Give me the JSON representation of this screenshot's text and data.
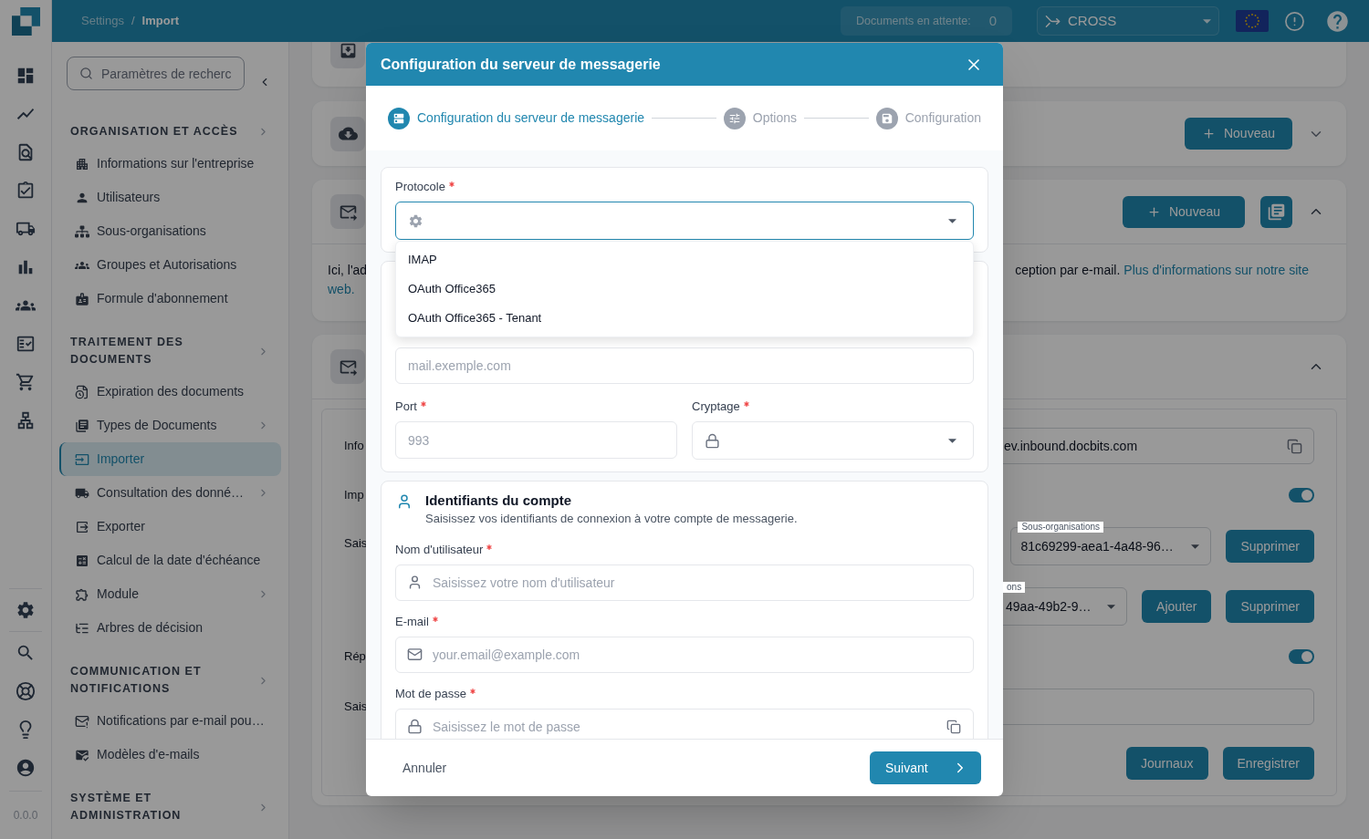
{
  "rail": {
    "version": "0.0.0"
  },
  "topbar": {
    "breadcrumb": [
      {
        "label": "Settings",
        "current": false
      },
      {
        "label": "Import",
        "current": true
      }
    ],
    "separator": "/",
    "pending": {
      "label": "Documents en attente:",
      "count": "0"
    },
    "workspace": {
      "value": "CROSS"
    }
  },
  "sidebar": {
    "search": {
      "placeholder": "Paramètres de recherc"
    },
    "sections": [
      {
        "title": "ORGANISATION ET ACCÈS",
        "items": [
          {
            "label": "Informations sur l'entreprise",
            "selected": false,
            "expandable": false
          },
          {
            "label": "Utilisateurs",
            "selected": false,
            "expandable": false
          },
          {
            "label": "Sous-organisations",
            "selected": false,
            "expandable": false
          },
          {
            "label": "Groupes et Autorisations",
            "selected": false,
            "expandable": false
          },
          {
            "label": "Formule d'abonnement",
            "selected": false,
            "expandable": false
          }
        ]
      },
      {
        "title": "TRAITEMENT DES DOCUMENTS",
        "items": [
          {
            "label": "Expiration des documents",
            "selected": false,
            "expandable": false
          },
          {
            "label": "Types de Documents",
            "selected": false,
            "expandable": true
          },
          {
            "label": "Importer",
            "selected": true,
            "expandable": false
          },
          {
            "label": "Consultation des donné…",
            "selected": false,
            "expandable": true
          },
          {
            "label": "Exporter",
            "selected": false,
            "expandable": false
          },
          {
            "label": "Calcul de la date d'échéance",
            "selected": false,
            "expandable": false
          },
          {
            "label": "Module",
            "selected": false,
            "expandable": true
          },
          {
            "label": "Arbres de décision",
            "selected": false,
            "expandable": false
          }
        ]
      },
      {
        "title": "COMMUNICATION ET NOTIFICATIONS",
        "items": [
          {
            "label": "Notifications par e-mail pou…",
            "selected": false,
            "expandable": false
          },
          {
            "label": "Modèles d'e-mails",
            "selected": false,
            "expandable": false
          }
        ]
      },
      {
        "title": "SYSTÈME ET ADMINISTRATION"
      }
    ]
  },
  "main": {
    "cards": [
      {
        "kind": "partial"
      },
      {
        "kind": "import",
        "expanded": false,
        "actions": [
          {
            "kind": "new",
            "label": "Nouveau"
          }
        ]
      },
      {
        "kind": "info",
        "expanded": true,
        "actions": [
          {
            "kind": "new",
            "label": "Nouveau"
          },
          {
            "kind": "docs"
          }
        ],
        "intro": {
          "start": "Ici, l'ad",
          "end": "ception par e-mail.",
          "link": "Plus d'informations sur notre site",
          "link_rest": "web."
        }
      },
      {
        "kind": "settings",
        "expanded": true,
        "rows": [
          {
            "kind": "copy_field",
            "label": "Info",
            "value": "ev.inbound.docbits.com"
          },
          {
            "kind": "toggle",
            "label": "Imp",
            "on": true
          },
          {
            "kind": "select",
            "label": "Sais",
            "select_label": "Sous-organisations",
            "value": "81c69299-aea1-4a48-96…",
            "buttons": [
              "Supprimer"
            ]
          },
          {
            "kind": "select",
            "select_label": "ons",
            "value": "49aa-49b2-9…",
            "buttons": [
              "Ajouter",
              "Supprimer"
            ]
          },
          {
            "kind": "toggle",
            "label": "Rép",
            "on": true
          },
          {
            "kind": "input",
            "label": "Sais"
          }
        ],
        "buttons": [
          "Journaux",
          "Enregistrer"
        ]
      }
    ]
  },
  "modal": {
    "title": "Configuration du serveur de messagerie",
    "steps": [
      {
        "label": "Configuration du serveur de messagerie",
        "selected": true
      },
      {
        "label": "Options",
        "selected": false
      },
      {
        "label": "Configuration",
        "selected": false
      }
    ],
    "protocol": {
      "label": "Protocole",
      "required": true,
      "expanded": true,
      "options": [
        {
          "label": "IMAP",
          "selected": false
        },
        {
          "label": "OAuth Office365",
          "selected": false
        },
        {
          "label": "OAuth Office365 - Tenant",
          "selected": false
        }
      ]
    },
    "server": {
      "placeholder": "mail.exemple.com"
    },
    "port": {
      "label": "Port",
      "required": true,
      "placeholder": "993"
    },
    "encryption": {
      "label": "Cryptage",
      "required": true
    },
    "credentials": {
      "title": "Identifiants du compte",
      "subtitle": "Saisissez vos identifiants de connexion à votre compte de messagerie.",
      "fields": [
        {
          "kind": "user",
          "label": "Nom d'utilisateur",
          "required": true,
          "placeholder": "Saisissez votre nom d'utilisateur"
        },
        {
          "kind": "email",
          "label": "E-mail",
          "required": true,
          "placeholder": "your.email@example.com"
        },
        {
          "kind": "password",
          "label": "Mot de passe",
          "required": true,
          "placeholder": "Saisissez le mot de passe"
        }
      ]
    },
    "footer": {
      "cancel": "Annuler",
      "next": "Suivant"
    }
  }
}
